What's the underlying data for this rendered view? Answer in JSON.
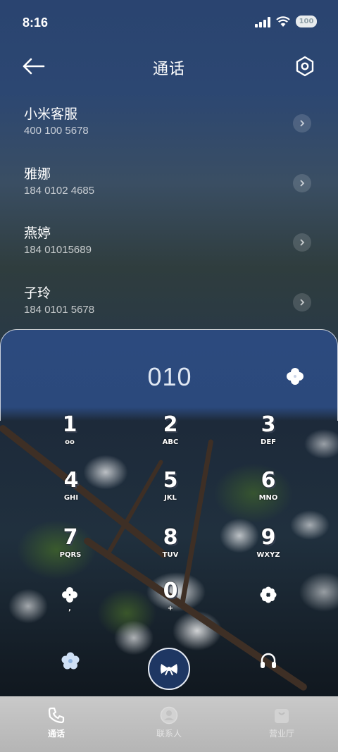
{
  "status_bar": {
    "time": "8:16",
    "battery": "100"
  },
  "header": {
    "title": "通话",
    "back_icon": "arrow-left-icon",
    "settings_icon": "hexagon-settings-icon"
  },
  "contacts": [
    {
      "name": "小米客服",
      "number": "400 100 5678"
    },
    {
      "name": "雅娜",
      "number": "184 0102 4685"
    },
    {
      "name": "燕婷",
      "number": "184 01015689"
    },
    {
      "name": "子玲",
      "number": "184 0101 5678"
    }
  ],
  "dialer": {
    "display": "010",
    "keys": [
      {
        "digit": "1",
        "letters": "oo"
      },
      {
        "digit": "2",
        "letters": "ABC"
      },
      {
        "digit": "3",
        "letters": "DEF"
      },
      {
        "digit": "4",
        "letters": "GHI"
      },
      {
        "digit": "5",
        "letters": "JKL"
      },
      {
        "digit": "6",
        "letters": "MNO"
      },
      {
        "digit": "7",
        "letters": "PQRS"
      },
      {
        "digit": "8",
        "letters": "TUV"
      },
      {
        "digit": "9",
        "letters": "WXYZ"
      },
      {
        "digit": "*",
        "letters": ","
      },
      {
        "digit": "0",
        "letters": "+"
      },
      {
        "digit": "#",
        "letters": ""
      }
    ]
  },
  "bottom_nav": [
    {
      "label": "通话",
      "icon": "phone-icon",
      "active": true
    },
    {
      "label": "联系人",
      "icon": "person-icon",
      "active": false
    },
    {
      "label": "营业厅",
      "icon": "bag-icon",
      "active": false
    }
  ],
  "colors": {
    "accent": "#2b497c",
    "call_button": "#1e3763",
    "nav_background": "#c0c0c0"
  }
}
